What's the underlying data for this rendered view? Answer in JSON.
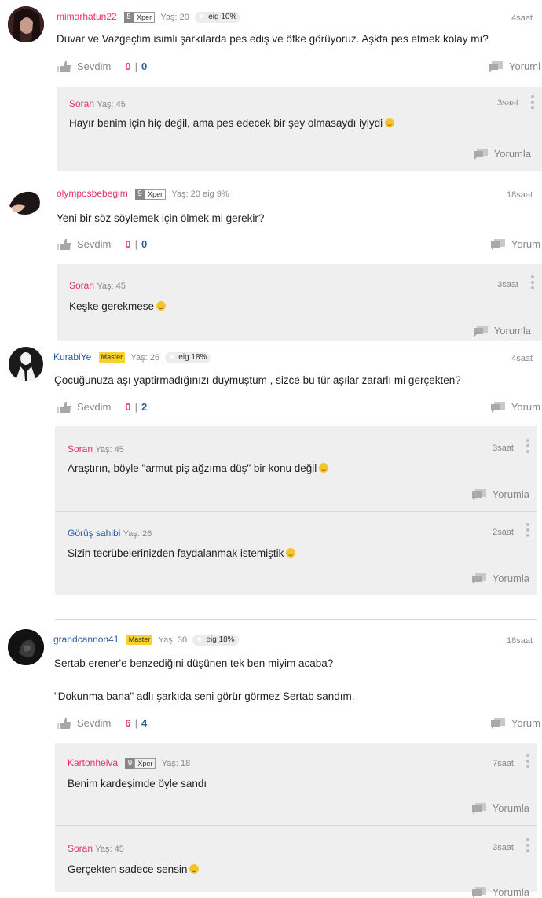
{
  "labels": {
    "like": "Sevdim",
    "separator": "|"
  },
  "comments": [
    {
      "username": "mimarhatun22",
      "level": "5",
      "badge": "Xper",
      "age": "Yaş: 20",
      "eig": "eig 10%",
      "time": "4saat",
      "text": "Duvar ve Vazgeçtim isimli şarkılarda pes ediş ve öfke görüyoruz. Aşkta pes etmek kolay mı?",
      "likes": "0",
      "dislikes": "0",
      "reply_label": "Yoruml",
      "replies": [
        {
          "name": "Soran",
          "age": "Yaş: 45",
          "time": "3saat",
          "text": "Hayır benim için hiç değil, ama pes edecek bir şey olmasaydı iyiydi",
          "reply_label": "Yorumla"
        }
      ]
    },
    {
      "username": "olymposbebegim",
      "level": "9",
      "badge": "Xper",
      "age": "Yaş: 20 eig 9%",
      "time": "18saat",
      "text": "Yeni bir söz söylemek için ölmek mi gerekir?",
      "likes": "0",
      "dislikes": "0",
      "reply_label": "Yorum",
      "replies": [
        {
          "name": "Soran",
          "age": "Yaş: 45",
          "time": "3saat",
          "text": "Keşke gerekmese",
          "reply_label": "Yorumla"
        }
      ]
    },
    {
      "username": "KurabiYe",
      "badge": "Master",
      "age": "Yaş: 26",
      "eig": "eig 18%",
      "time": "4saat",
      "text": "Çocuğunuza aşı yaptirmadığınızı duymuştum , sizce bu tür aşılar zararlı mi gerçekten?",
      "likes": "0",
      "dislikes": "2",
      "reply_label": "Yorum",
      "replies": [
        {
          "name": "Soran",
          "age": "Yaş: 45",
          "time": "3saat",
          "text": "Araştırın, böyle \"armut piş ağzıma düş\" bir konu değil",
          "reply_label": "Yorumla"
        },
        {
          "name": "Görüş sahibi",
          "age": "Yaş: 26",
          "time": "2saat",
          "text": "Sizin tecrübelerinizden faydalanmak istemiştik",
          "reply_label": "Yorumla"
        }
      ]
    },
    {
      "username": "grandcannon41",
      "badge": "Master",
      "age": "Yaş: 30",
      "eig": "eig 18%",
      "time": "18saat",
      "text": "Sertab erener'e benzediğini düşünen tek ben miyim acaba?",
      "text2": "\"Dokunma bana\" adlı şarkıda seni görür görmez Sertab sandım.",
      "likes": "6",
      "dislikes": "4",
      "reply_label": "Yorum",
      "replies": [
        {
          "name": "Kartonhelva",
          "level": "9",
          "badge": "Xper",
          "age": "Yaş: 18",
          "time": "7saat",
          "text": "Benim kardeşimde öyle sandı",
          "reply_label": "Yorumla"
        },
        {
          "name": "Soran",
          "age": "Yaş: 45",
          "time": "3saat",
          "text": "Gerçekten sadece sensin",
          "reply_label": "Yorumla"
        }
      ]
    }
  ]
}
